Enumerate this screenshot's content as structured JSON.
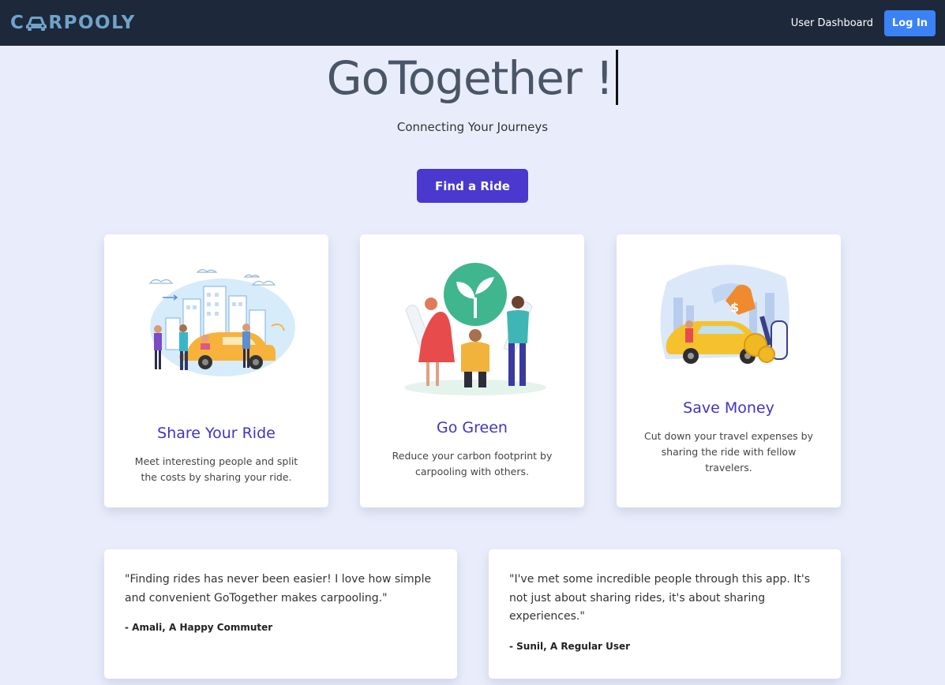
{
  "nav": {
    "logo_before": "C",
    "logo_after": "RPOOLY",
    "dashboard_link": "User Dashboard",
    "login_label": "Log In"
  },
  "hero": {
    "title": "GoTogether !",
    "tagline": "Connecting Your Journeys",
    "cta_label": "Find a Ride"
  },
  "features": [
    {
      "title": "Share Your Ride",
      "description": "Meet interesting people and split the costs by sharing your ride."
    },
    {
      "title": "Go Green",
      "description": "Reduce your carbon footprint by carpooling with others."
    },
    {
      "title": "Save Money",
      "description": "Cut down your travel expenses by sharing the ride with fellow travelers."
    }
  ],
  "testimonials": [
    {
      "quote": "\"Finding rides has never been easier! I love how simple and convenient GoTogether makes carpooling.\"",
      "author": "- Amali, A Happy Commuter"
    },
    {
      "quote": "\"I've met some incredible people through this app. It's not just about sharing rides, it's about sharing experiences.\"",
      "author": "- Sunil, A Regular User"
    }
  ],
  "colors": {
    "navbar": "#1d283a",
    "page_background": "#e9edfb",
    "accent_purple": "#4a38cf",
    "login_blue": "#3b82f6",
    "feature_title": "#3f34c6"
  },
  "icons": [
    "car-icon",
    "share-ride-illustration",
    "go-green-illustration",
    "save-money-illustration"
  ]
}
